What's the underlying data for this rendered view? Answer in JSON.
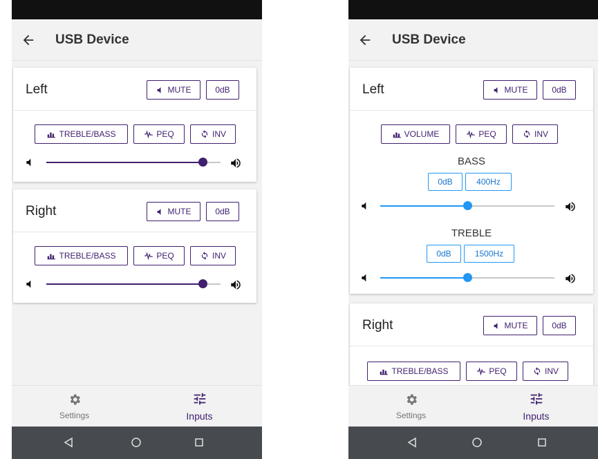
{
  "phones": [
    {
      "app_title": "USB Device",
      "left": {
        "name": "Left",
        "mute_label": "MUTE",
        "gain_label": "0dB",
        "mode_label": "TREBLE/BASS",
        "peq_label": "PEQ",
        "inv_label": "INV",
        "volume_level": 0.9
      },
      "right": {
        "name": "Right",
        "mute_label": "MUTE",
        "gain_label": "0dB",
        "mode_label": "TREBLE/BASS",
        "peq_label": "PEQ",
        "inv_label": "INV",
        "volume_level": 0.9
      },
      "nav": {
        "settings_label": "Settings",
        "inputs_label": "Inputs"
      }
    },
    {
      "app_title": "USB Device",
      "left": {
        "name": "Left",
        "mute_label": "MUTE",
        "gain_label": "0dB",
        "mode_label": "VOLUME",
        "peq_label": "PEQ",
        "inv_label": "INV",
        "bass": {
          "label": "BASS",
          "gain": "0dB",
          "freq": "400Hz",
          "level": 0.5
        },
        "treble": {
          "label": "TREBLE",
          "gain": "0dB",
          "freq": "1500Hz",
          "level": 0.5
        }
      },
      "right": {
        "name": "Right",
        "mute_label": "MUTE",
        "gain_label": "0dB",
        "mode_label": "TREBLE/BASS",
        "peq_label": "PEQ",
        "inv_label": "INV"
      },
      "nav": {
        "settings_label": "Settings",
        "inputs_label": "Inputs"
      }
    }
  ],
  "colors": {
    "accent": "#3f1f6e",
    "blue": "#2196f3",
    "track_inactive": "#c8c8c8"
  }
}
